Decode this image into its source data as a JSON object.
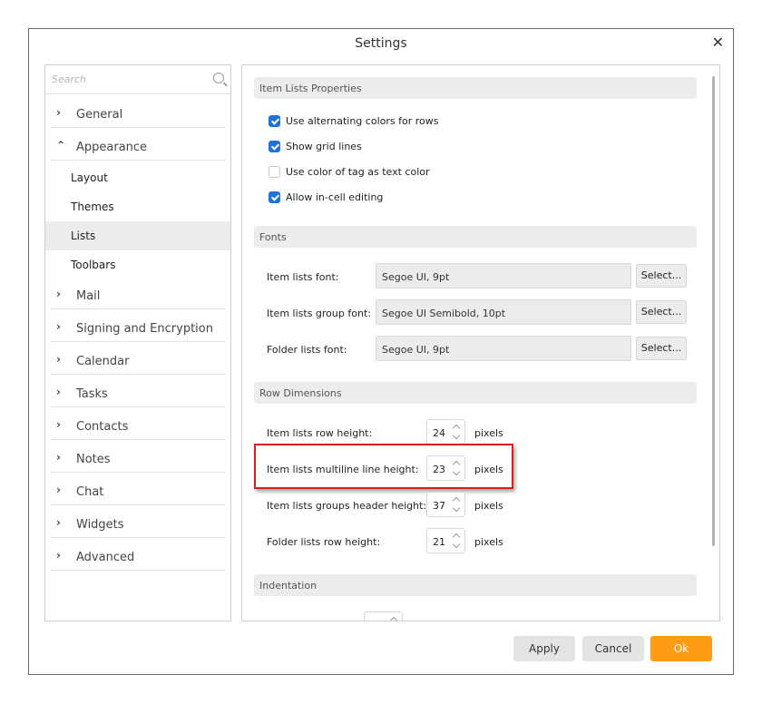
{
  "dialog": {
    "title": "Settings",
    "close_glyph": "✕"
  },
  "search": {
    "placeholder": "Search"
  },
  "sidebar": {
    "items": [
      {
        "label": "General",
        "chevron": "›",
        "expanded": false
      },
      {
        "label": "Appearance",
        "chevron": "⌃",
        "expanded": true,
        "children": [
          "Layout",
          "Themes",
          "Lists",
          "Toolbars"
        ],
        "selected_child": "Lists"
      },
      {
        "label": "Mail",
        "chevron": "›"
      },
      {
        "label": "Signing and Encryption",
        "chevron": "›"
      },
      {
        "label": "Calendar",
        "chevron": "›"
      },
      {
        "label": "Tasks",
        "chevron": "›"
      },
      {
        "label": "Contacts",
        "chevron": "›"
      },
      {
        "label": "Notes",
        "chevron": "›"
      },
      {
        "label": "Chat",
        "chevron": "›"
      },
      {
        "label": "Widgets",
        "chevron": "›"
      },
      {
        "label": "Advanced",
        "chevron": "›"
      }
    ]
  },
  "item_lists": {
    "header": "Item Lists Properties",
    "options": [
      {
        "label": "Use alternating colors for rows",
        "checked": true
      },
      {
        "label": "Show grid lines",
        "checked": true
      },
      {
        "label": "Use color of tag as text color",
        "checked": false
      },
      {
        "label": "Allow in-cell editing",
        "checked": true
      }
    ]
  },
  "fonts": {
    "header": "Fonts",
    "select_label": "Select...",
    "rows": [
      {
        "label": "Item lists font:",
        "value": "Segoe UI, 9pt"
      },
      {
        "label": "Item lists group font:",
        "value": "Segoe UI Semibold, 10pt"
      },
      {
        "label": "Folder lists font:",
        "value": "Segoe UI, 9pt"
      }
    ]
  },
  "row_dimensions": {
    "header": "Row Dimensions",
    "unit": "pixels",
    "rows": [
      {
        "label": "Item lists row height:",
        "value": "24"
      },
      {
        "label": "Item lists multiline line height:",
        "value": "23",
        "highlighted": true
      },
      {
        "label": "Item lists groups header height:",
        "value": "37"
      },
      {
        "label": "Folder lists row height:",
        "value": "21"
      }
    ]
  },
  "indentation": {
    "header": "Indentation"
  },
  "buttons": {
    "apply": "Apply",
    "cancel": "Cancel",
    "ok": "Ok"
  },
  "colors": {
    "accent": "#ff9b14",
    "checkbox": "#1e73d9",
    "highlight": "#d52020"
  }
}
